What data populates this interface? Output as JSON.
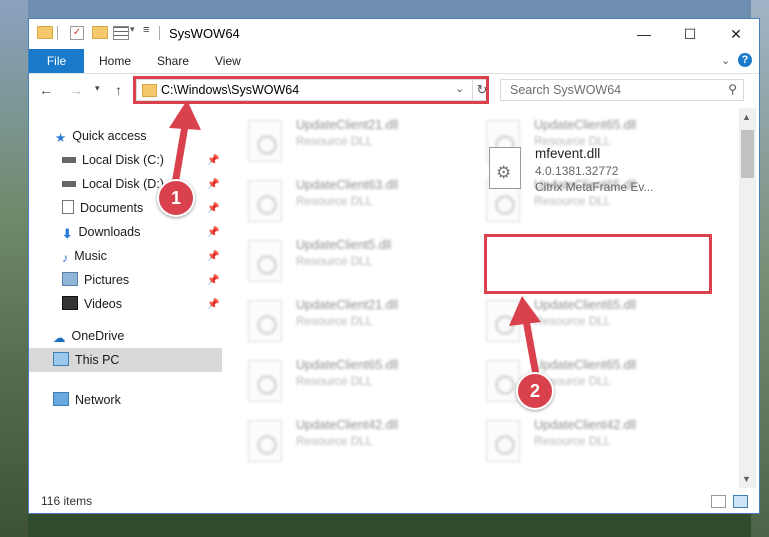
{
  "window": {
    "title": "SysWOW64",
    "controls": {
      "minimize": "—",
      "maximize": "☐",
      "close": "✕"
    }
  },
  "ribbon": {
    "tabs": [
      "File",
      "Home",
      "Share",
      "View"
    ],
    "help": "?"
  },
  "address": {
    "path": "C:\\Windows\\SysWOW64"
  },
  "search": {
    "placeholder": "Search SysWOW64"
  },
  "nav": {
    "quick_access": "Quick access",
    "items": [
      {
        "label": "Local Disk (C:)",
        "icon": "drive-icon",
        "pinned": true
      },
      {
        "label": "Local Disk (D:)",
        "icon": "drive-icon",
        "pinned": true
      },
      {
        "label": "Documents",
        "icon": "documents-icon",
        "pinned": true
      },
      {
        "label": "Downloads",
        "icon": "download-icon",
        "pinned": true
      },
      {
        "label": "Music",
        "icon": "music-icon",
        "pinned": true
      },
      {
        "label": "Pictures",
        "icon": "pictures-icon",
        "pinned": true
      },
      {
        "label": "Videos",
        "icon": "videos-icon",
        "pinned": true
      }
    ],
    "onedrive": "OneDrive",
    "this_pc": "This PC",
    "network": "Network"
  },
  "files_left": [
    {
      "name": "UpdateClient21.dll",
      "desc": "Resource DLL"
    },
    {
      "name": "UpdateClient63.dll",
      "desc": "Resource DLL"
    },
    {
      "name": "UpdateClient5.dll",
      "desc": "Resource DLL"
    },
    {
      "name": "UpdateClient21.dll",
      "desc": "Resource DLL"
    },
    {
      "name": "UpdateClient65.dll",
      "desc": "Resource DLL"
    },
    {
      "name": "UpdateClient42.dll",
      "desc": "Resource DLL"
    }
  ],
  "files_right": [
    {
      "name": "UpdateClient65.dll",
      "desc": "Resource DLL"
    },
    {
      "name": "UpdateClient65.dll",
      "desc": "Resource DLL"
    },
    {
      "name": "UpdateClient65.dll",
      "desc": "Resource DLL"
    },
    {
      "name": "UpdateClient65.dll",
      "desc": "Resource DLL"
    },
    {
      "name": "UpdateClient42.dll",
      "desc": "Resource DLL"
    }
  ],
  "selected_file": {
    "name": "mfevent.dll",
    "version": "4.0.1381.32772",
    "description": "Citrix MetaFrame Ev..."
  },
  "status": {
    "item_count": "116 items"
  },
  "callouts": [
    "1",
    "2"
  ],
  "colors": {
    "accent": "#1979ca",
    "highlight": "#d9414c"
  }
}
